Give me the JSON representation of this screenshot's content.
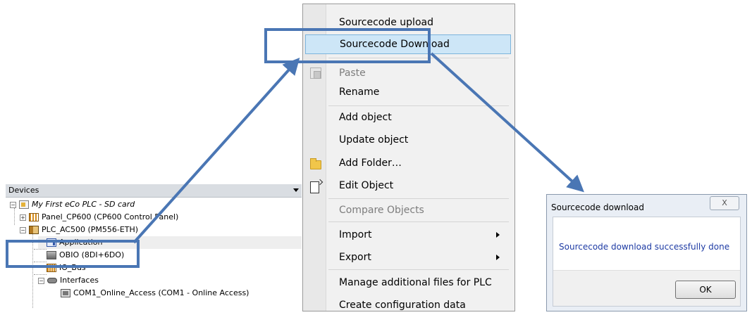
{
  "tree": {
    "header": "Devices",
    "items": [
      {
        "label": "My First eCo PLC - SD card"
      },
      {
        "label": "Panel_CP600 (CP600 Control Panel)"
      },
      {
        "label": "PLC_AC500 (PM556-ETH)"
      },
      {
        "label": "Application"
      },
      {
        "label": "OBIO (8DI+6DO)"
      },
      {
        "label": "IO_Bus"
      },
      {
        "label": "Interfaces"
      },
      {
        "label": "COM1_Online_Access (COM1 - Online Access)"
      }
    ],
    "expand_minus": "−",
    "expand_plus": "+"
  },
  "menu": {
    "items": [
      {
        "label": "Sourcecode upload"
      },
      {
        "label": "Sourcecode Download"
      },
      {
        "label": "Paste"
      },
      {
        "label": "Rename"
      },
      {
        "label": "Add object"
      },
      {
        "label": "Update object"
      },
      {
        "label": "Add Folder…"
      },
      {
        "label": "Edit Object"
      },
      {
        "label": "Compare Objects"
      },
      {
        "label": "Import"
      },
      {
        "label": "Export"
      },
      {
        "label": "Manage additional files for PLC"
      },
      {
        "label": "Create configuration data"
      }
    ]
  },
  "dialog": {
    "title": "Sourcecode download",
    "close": "X",
    "message": "Sourcecode download successfully done",
    "ok": "OK"
  },
  "colors": {
    "annotation": "#4a76b4",
    "menu_highlight": "#cde6f7",
    "dialog_text": "#1e3ba4"
  }
}
